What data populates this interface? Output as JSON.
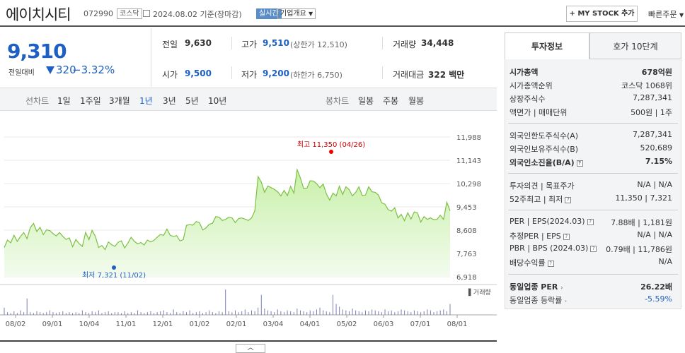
{
  "header": {
    "company": "에이치시티",
    "code": "072990",
    "market": "코스닥",
    "date": "2024.08.02 기준(장마감)",
    "live": "실시간",
    "info": "기업개요",
    "my_stock": "+ MY STOCK 추가",
    "quick_order": "빠른주문"
  },
  "price": {
    "current": "9,310",
    "compare_label": "전일대비",
    "change": "320",
    "change_pct": "−3.32%",
    "color": "#1d5fc2"
  },
  "stats": {
    "prev_label": "전일",
    "prev": "9,630",
    "high_label": "고가",
    "high": "9,510",
    "upper_limit": "(상한가 12,510)",
    "volume_label": "거래량",
    "volume": "34,448",
    "open_label": "시가",
    "open": "9,500",
    "low_label": "저가",
    "low": "9,200",
    "lower_limit": "(하한가 6,750)",
    "amount_label": "거래대금",
    "amount": "322 백만"
  },
  "tabs": {
    "line_label": "선차트",
    "line_items": [
      "1일",
      "1주일",
      "3개월",
      "1년",
      "3년",
      "5년",
      "10년"
    ],
    "selected": "1년",
    "candle_label": "봉차트",
    "candle_items": [
      "일봉",
      "주봉",
      "월봉"
    ]
  },
  "chart_data": {
    "type": "area",
    "period": "1년",
    "x_ticks": [
      "08/02",
      "09/01",
      "10/04",
      "11/01",
      "12/01",
      "01/02",
      "02/01",
      "03/04",
      "04/01",
      "05/02",
      "06/03",
      "07/01",
      "08/01"
    ],
    "y_ticks": [
      "11,988",
      "11,143",
      "10,298",
      "9,453",
      "8,608",
      "7,763",
      "6,918"
    ],
    "ylim": [
      6918,
      11988
    ],
    "max_label": "최고 11,350 (04/26)",
    "min_label": "최저 7,321 (11/02)",
    "volume_label": "거래량",
    "series": [
      {
        "values": [
          7980,
          8250,
          8150,
          8420,
          8200,
          8380,
          8520,
          8300,
          8700,
          8850,
          8560,
          8710,
          8450,
          8620,
          8590,
          8480,
          8400,
          8520,
          8380,
          8270,
          8330,
          8010,
          8270,
          8120,
          8020,
          8530,
          8260,
          8600,
          8380,
          7980,
          8050,
          7900,
          8180,
          8080,
          8020,
          8170,
          8220,
          7960,
          8140,
          8350,
          8200,
          8110,
          8160,
          8070,
          8250,
          8180,
          8240,
          8350,
          8450,
          8420,
          8650,
          8420,
          8380,
          8410,
          8220,
          8260,
          8780,
          8810,
          8790,
          8920,
          8880,
          8610,
          8690,
          8820,
          8860,
          9100,
          9080,
          8960,
          9000,
          9080,
          9050,
          8880,
          9030,
          9050,
          9010,
          8960,
          9050,
          9310,
          10550,
          10350,
          9980,
          10210,
          10150,
          10090,
          10000,
          9850,
          10050,
          9860,
          10200,
          9950,
          10800,
          10500,
          10120,
          10130,
          10400,
          10390,
          10290,
          10150,
          10280,
          9920,
          9700,
          9950,
          9850,
          10200,
          9900,
          10180,
          10080,
          9850,
          9980,
          10180,
          9870,
          9880,
          10180,
          10000,
          9980,
          9880,
          9600,
          9550,
          9350,
          9300,
          9420,
          9050,
          9180,
          8950,
          9240,
          9010,
          9270,
          9230,
          8900,
          9100,
          9000,
          9050,
          8990,
          9000,
          9150,
          9000,
          9620,
          9310
        ],
        "color": "#7bc043"
      }
    ],
    "volume": [
      8,
      3,
      2,
      4,
      2,
      5,
      3,
      18,
      3,
      2,
      4,
      3,
      2,
      3,
      5,
      3,
      2,
      3,
      4,
      2,
      3,
      2,
      3,
      2,
      5,
      3,
      2,
      4,
      3,
      5,
      2,
      3,
      4,
      2,
      3,
      3,
      2,
      4,
      2,
      3,
      2,
      5,
      3,
      2,
      3,
      4,
      2,
      3,
      4,
      5,
      3,
      2,
      6,
      3,
      2,
      4,
      3,
      5,
      2,
      3,
      4,
      2,
      3,
      5,
      3,
      2,
      4,
      3,
      28,
      4,
      3,
      5,
      3,
      4,
      6,
      3,
      5,
      4,
      8,
      22,
      7,
      5,
      4,
      3,
      6,
      4,
      3,
      5,
      4,
      3,
      7,
      5,
      4,
      3,
      5,
      4,
      6,
      8,
      5,
      4,
      3,
      22,
      12,
      9,
      6,
      5,
      4,
      7,
      5,
      4,
      3,
      5,
      4,
      6,
      5,
      4,
      3,
      6,
      4,
      5,
      3,
      4,
      6,
      5,
      4,
      3,
      5,
      4,
      3,
      4,
      6,
      5,
      3,
      4,
      5,
      6,
      4,
      12
    ]
  },
  "side": {
    "tab_invest": "투자정보",
    "tab_quote": "호가 10단계",
    "market_cap_label": "시가총액",
    "market_cap": "678억원",
    "cap_rank_label": "시가총액순위",
    "cap_rank": "코스닥 1068위",
    "shares_label": "상장주식수",
    "shares": "7,287,341",
    "par_label": "액면가 | 매매단위",
    "par": "500원 | 1주",
    "foreign_limit_label": "외국인한도주식수(A)",
    "foreign_limit": "7,287,341",
    "foreign_hold_label": "외국인보유주식수(B)",
    "foreign_hold": "520,689",
    "foreign_rate_label": "외국인소진율(B/A)",
    "foreign_rate": "7.15%",
    "opinion_label": "투자의견 | 목표주가",
    "opinion": "N/A | N/A",
    "w52_label": "52주최고 | 최저",
    "w52": "11,350 | 7,321",
    "per_label": "PER | EPS(2024.03)",
    "per": "7.88배 | 1,181원",
    "est_per_label": "추정PER | EPS",
    "est_per": "N/A | N/A",
    "pbr_label": "PBR | BPS (2024.03)",
    "pbr": "0.79배 | 11,786원",
    "div_label": "배당수익률",
    "div": "N/A",
    "ind_per_label": "동일업종 PER",
    "ind_per": "26.22배",
    "ind_rate_label": "동일업종 등락률",
    "ind_rate": "-5.59%"
  }
}
